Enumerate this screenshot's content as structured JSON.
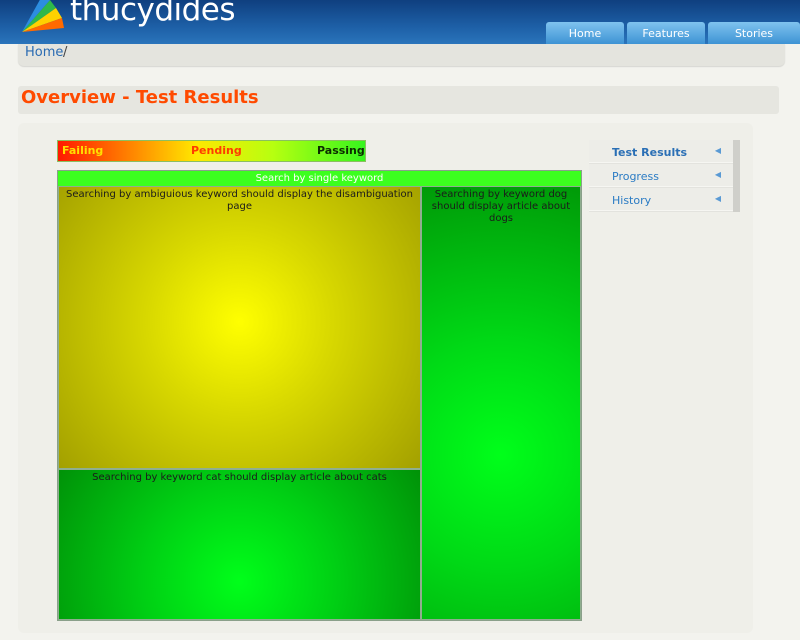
{
  "header": {
    "logo_text": "thucydides",
    "nav": [
      "Home",
      "Features",
      "Stories"
    ]
  },
  "breadcrumb": {
    "home": "Home",
    "separator": "/"
  },
  "page": {
    "title": "Overview - Test Results"
  },
  "legend": {
    "failing": "Failing",
    "pending": "Pending",
    "passing": "Passing"
  },
  "treemap": {
    "header": "Search by single keyword",
    "cells": [
      {
        "label": "Searching by ambiguious keyword should display the disambiguation page",
        "status": "pending"
      },
      {
        "label": "Searching by keyword cat should display article about cats",
        "status": "passing"
      },
      {
        "label": "Searching by keyword dog should display article about dogs",
        "status": "passing"
      }
    ]
  },
  "side_menu": {
    "items": [
      {
        "label": "Test Results",
        "active": true
      },
      {
        "label": "Progress",
        "active": false
      },
      {
        "label": "History",
        "active": false
      }
    ],
    "chevron": "◀"
  },
  "colors": {
    "title": "#ff4a00",
    "header_bg": "#1d5fa6",
    "passing": "#00e016",
    "pending": "#e6e600",
    "failing": "#ff1a00"
  }
}
